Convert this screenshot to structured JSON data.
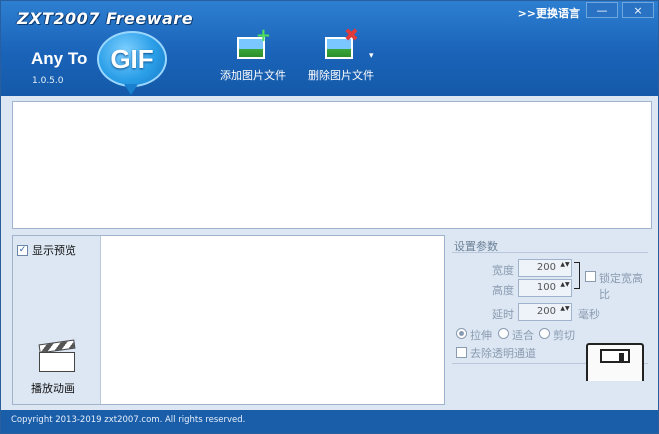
{
  "header": {
    "brand": "ZXT2007 Freeware",
    "product_prefix": "Any To",
    "product_badge": "GIF",
    "version": "1.0.5.0",
    "language_link": ">>更换语言",
    "minimize": "—",
    "close": "×"
  },
  "toolbar": {
    "add_label": "添加图片文件",
    "delete_label": "删除图片文件",
    "dropdown_glyph": "▾"
  },
  "preview": {
    "show_preview_label": "显示预览",
    "show_preview_checked": "✓",
    "play_label": "播放动画"
  },
  "settings": {
    "title": "设置参数",
    "width_label": "宽度",
    "width_value": "200",
    "height_label": "高度",
    "height_value": "100",
    "lock_ratio_label": "锁定宽高比",
    "delay_label": "延时",
    "delay_value": "200",
    "delay_unit": "毫秒",
    "spin_arrows": "▲▼",
    "mode_stretch": "拉伸",
    "mode_fit": "适合",
    "mode_crop": "剪切",
    "remove_alpha_label": "去除透明通道"
  },
  "status": {
    "copyright": "Copyright 2013-2019 zxt2007.com. All rights reserved."
  },
  "colors": {
    "header_blue": "#1a63b8",
    "status_blue": "#1a5ea9",
    "panel_bg": "#dce7f3"
  }
}
